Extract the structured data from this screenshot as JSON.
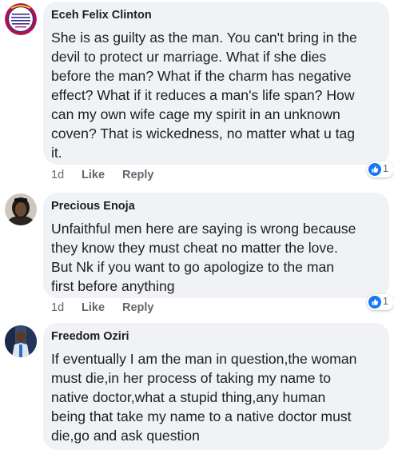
{
  "colors": {
    "bubble_bg": "#f0f2f5",
    "name_text": "#1c1e21",
    "meta_text": "#65676b",
    "reaction_blue": "#1877f2"
  },
  "comments": [
    {
      "author": "Eceh Felix Clinton",
      "lines": [
        "She is as guilty as the man. You can't bring in the",
        "devil to protect ur marriage. What if she dies",
        "before the man? What if the charm has negative",
        "effect? What if it reduces a man's life span? How",
        "can my own wife cage my spirit in an unknown",
        "coven? That is wickedness, no matter what u tag",
        "it."
      ],
      "time": "1d",
      "like": "Like",
      "reply": "Reply",
      "reaction_icon": "like-thumb-icon",
      "reaction_count": "1"
    },
    {
      "author": "Precious Enoja",
      "lines": [
        "Unfaithful men here are saying is wrong because",
        "they know they must cheat no matter the love.",
        "But Nk if you want to go apologize to the man",
        "first before anything"
      ],
      "time": "1d",
      "like": "Like",
      "reply": "Reply",
      "reaction_icon": "like-thumb-icon",
      "reaction_count": "1"
    },
    {
      "author": "Freedom Oziri",
      "lines": [
        "If eventually I am the man in question,the woman",
        "must die,in her process of taking my name to",
        "native doctor,what a stupid thing,any human",
        "being that take my name to a native doctor must",
        "die,go and ask question"
      ]
    }
  ]
}
